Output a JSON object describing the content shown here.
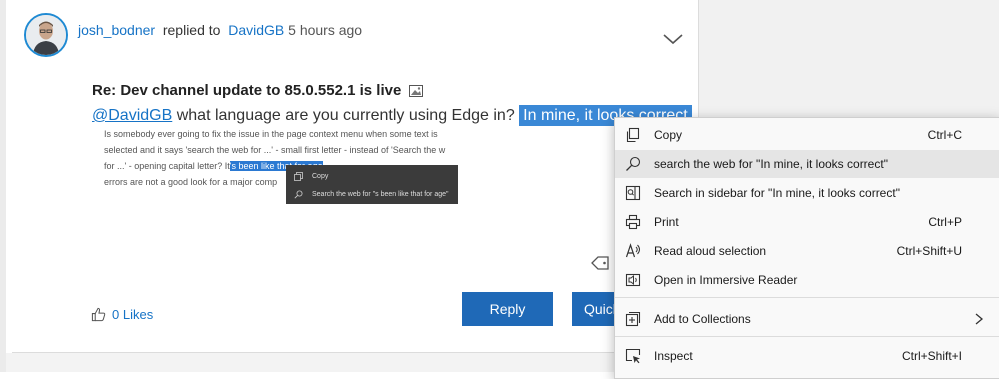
{
  "post": {
    "author": "josh_bodner",
    "action": "replied to",
    "recipient": "DavidGB",
    "time": "5 hours ago",
    "title": "Re: Dev channel update to 85.0.552.1 is live",
    "mention": "@DavidGB",
    "body_text": " what language are you currently using Edge in? ",
    "selected_text": "In mine, it looks correct"
  },
  "embedded_screenshot": {
    "line1": "Is somebody ever going to fix the issue in the page context menu when some text is",
    "line2": "selected and it says 'search the web for ...' - small first letter - instead of 'Search the w",
    "line3_before": "for ...' - opening capital letter? It",
    "line3_selected": "'s been like that for age",
    "line4": "errors are not a good look for a major comp",
    "menu_copy": "Copy",
    "menu_search": "Search the web for \"s been like that for age\""
  },
  "footer": {
    "likes": "0 Likes",
    "reply": "Reply",
    "quick": "Quick"
  },
  "context_menu": {
    "copy": {
      "label": "Copy",
      "shortcut": "Ctrl+C"
    },
    "search_web": {
      "label": "search the web for \"In mine, it looks correct\""
    },
    "search_sidebar": {
      "label": "Search in sidebar for \"In mine, it looks correct\""
    },
    "print": {
      "label": "Print",
      "shortcut": "Ctrl+P"
    },
    "read_aloud": {
      "label": "Read aloud selection",
      "shortcut": "Ctrl+Shift+U"
    },
    "immersive": {
      "label": "Open in Immersive Reader"
    },
    "collections": {
      "label": "Add to Collections"
    },
    "inspect": {
      "label": "Inspect",
      "shortcut": "Ctrl+Shift+I"
    }
  },
  "colors": {
    "accent_link": "#1673c6",
    "button": "#1f69b7",
    "selection": "#3a88d6"
  },
  "icons": [
    "user-avatar",
    "chevron-down-icon",
    "image-icon",
    "tag-icon",
    "thumbs-up-icon",
    "copy-icon",
    "search-icon",
    "sidebar-search-icon",
    "print-icon",
    "read-aloud-icon",
    "immersive-reader-icon",
    "collections-icon",
    "chevron-right-icon",
    "inspect-icon"
  ]
}
